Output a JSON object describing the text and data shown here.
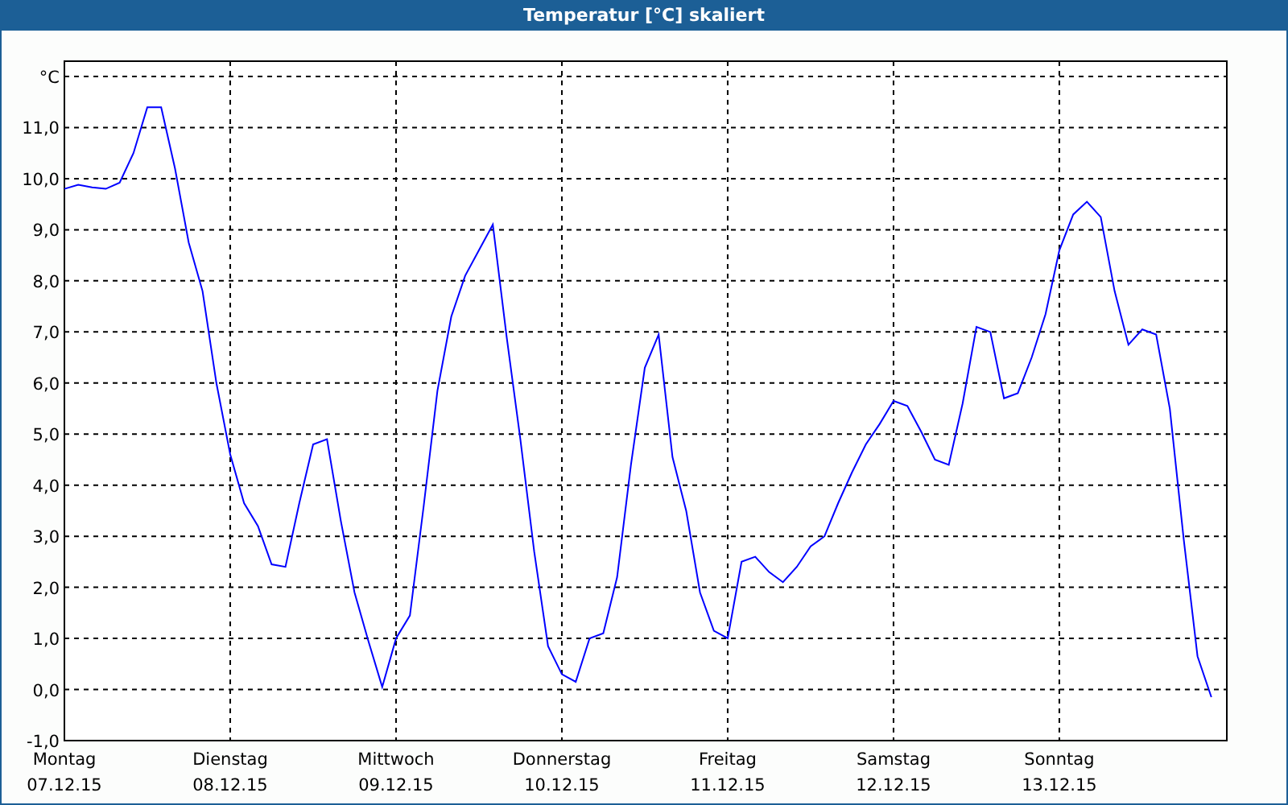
{
  "window": {
    "title": "Temperatur [°C] skaliert"
  },
  "chart": {
    "chart_data": {
      "type": "line",
      "grid": true,
      "ylabel": "°C",
      "ylim": [
        -1,
        12.3
      ],
      "yticks": [
        {
          "value": -1,
          "label": "-1,0"
        },
        {
          "value": 0,
          "label": "0,0"
        },
        {
          "value": 1,
          "label": "1,0"
        },
        {
          "value": 2,
          "label": "2,0"
        },
        {
          "value": 3,
          "label": "3,0"
        },
        {
          "value": 4,
          "label": "4,0"
        },
        {
          "value": 5,
          "label": "5,0"
        },
        {
          "value": 6,
          "label": "6,0"
        },
        {
          "value": 7,
          "label": "7,0"
        },
        {
          "value": 8,
          "label": "8,0"
        },
        {
          "value": 9,
          "label": "9,0"
        },
        {
          "value": 10,
          "label": "10,0"
        },
        {
          "value": 11,
          "label": "11,0"
        }
      ],
      "categories": [
        "Montag\n07.12.15",
        null,
        null,
        null,
        null,
        null,
        null,
        null,
        null,
        null,
        null,
        null,
        "Dienstag\n08.12.15",
        null,
        null,
        null,
        null,
        null,
        null,
        null,
        null,
        null,
        null,
        null,
        "Mittwoch\n09.12.15",
        null,
        null,
        null,
        null,
        null,
        null,
        null,
        null,
        null,
        null,
        null,
        "Donnerstag\n10.12.15",
        null,
        null,
        null,
        null,
        null,
        null,
        null,
        null,
        null,
        null,
        null,
        "Freitag\n11.12.15",
        null,
        null,
        null,
        null,
        null,
        null,
        null,
        null,
        null,
        null,
        null,
        "Samstag\n12.12.15",
        null,
        null,
        null,
        null,
        null,
        null,
        null,
        null,
        null,
        null,
        null,
        "Sonntag\n13.12.15",
        null,
        null,
        null,
        null,
        null,
        null,
        null,
        null,
        null,
        null,
        null
      ],
      "series": [
        {
          "color": "#0000ff",
          "values": [
            9.8,
            9.88,
            9.83,
            9.8,
            9.92,
            10.5,
            11.4,
            11.4,
            10.2,
            8.75,
            7.8,
            6.0,
            4.6,
            3.65,
            3.2,
            2.45,
            2.4,
            3.65,
            4.8,
            4.9,
            3.3,
            1.9,
            0.95,
            0.05,
            1.0,
            1.45,
            3.6,
            5.85,
            7.3,
            8.1,
            8.6,
            9.1,
            6.9,
            4.9,
            2.7,
            0.85,
            0.3,
            0.15,
            1.0,
            1.1,
            2.2,
            4.4,
            6.3,
            6.95,
            4.55,
            3.5,
            1.9,
            1.15,
            1.0,
            2.5,
            2.6,
            2.3,
            2.1,
            2.4,
            2.8,
            3.0,
            3.65,
            4.25,
            4.8,
            5.2,
            5.65,
            5.55,
            5.05,
            4.5,
            4.4,
            5.6,
            7.1,
            7.0,
            5.7,
            5.8,
            6.5,
            7.35,
            8.6,
            9.3,
            9.55,
            9.25,
            7.8,
            6.75,
            7.05,
            6.95,
            5.5,
            2.95,
            0.65,
            -0.15
          ]
        }
      ]
    }
  }
}
